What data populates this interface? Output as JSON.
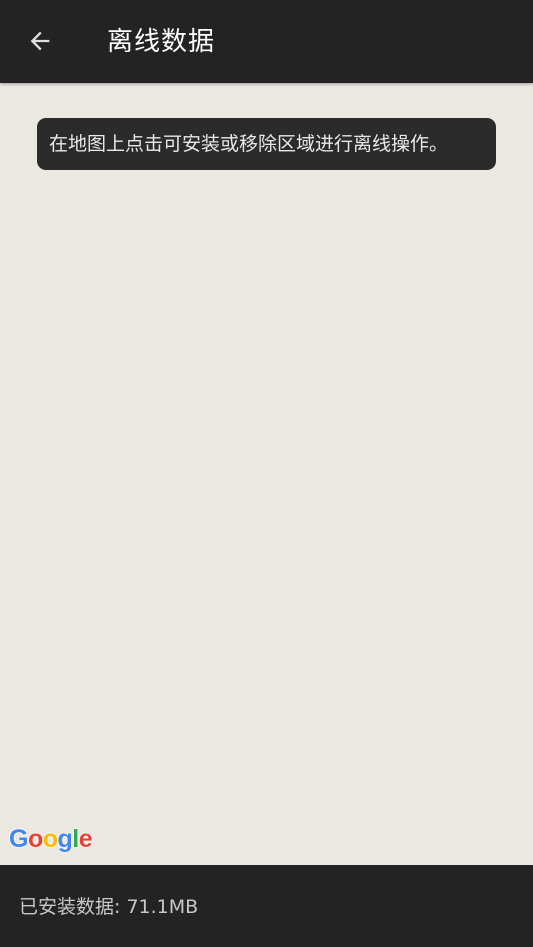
{
  "header": {
    "title": "离线数据",
    "back_icon": "arrow-left-icon"
  },
  "map": {
    "hint": "在地图上点击可安装或移除区域进行离线操作。",
    "attribution": {
      "letters": [
        "G",
        "o",
        "o",
        "g",
        "l",
        "e"
      ],
      "colors": [
        "#4285F4",
        "#EA4335",
        "#FBBC05",
        "#4285F4",
        "#34A853",
        "#EA4335"
      ]
    }
  },
  "footer": {
    "installed_text": "已安装数据: 71.1MB"
  },
  "colors": {
    "bar_background": "#232323",
    "map_background": "#ebe8e1",
    "toast_background": "#2b2b2b"
  }
}
